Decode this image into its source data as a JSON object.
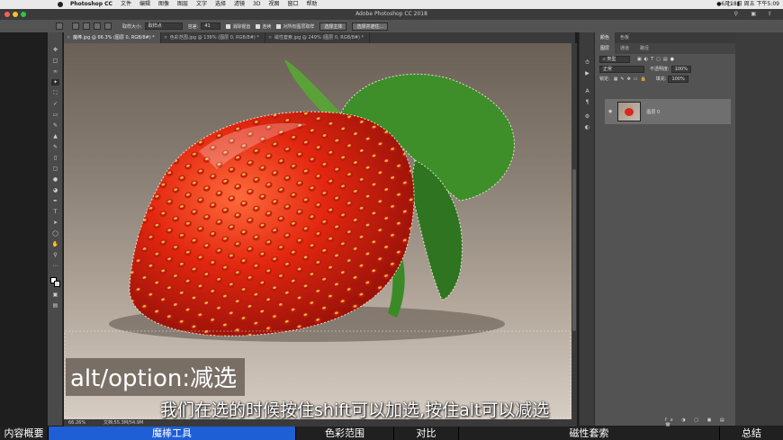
{
  "menubar": {
    "app": "Photoshop CC",
    "items": [
      "文件",
      "编辑",
      "图像",
      "图层",
      "文字",
      "选择",
      "滤镜",
      "3D",
      "视图",
      "窗口",
      "帮助"
    ],
    "clock": "6月18日 周五 下午5:09"
  },
  "window": {
    "title": "Adobe Photoshop CC 2018"
  },
  "options": {
    "sample_size_label": "取样大小:",
    "sample_size_value": "取样点",
    "tolerance_label": "容差:",
    "tolerance_value": "41",
    "antialias_label": "消除锯齿",
    "contiguous_label": "连续",
    "all_layers_label": "对所有图层取样",
    "select_subject": "选择主体",
    "select_mask": "选择并遮住..."
  },
  "tabs": [
    {
      "label": "魔棒.jpg @ 66.3% (图层 0, RGB/8#) *"
    },
    {
      "label": "色彩范围.jpg @ 138% (图层 0, RGB/8#) *"
    },
    {
      "label": "磁性套索.jpg @ 249% (图层 0, RGB/8#) *"
    }
  ],
  "status": {
    "zoom": "66.26%",
    "doc": "文档:55.3M/54.9M"
  },
  "panel": {
    "tabs": [
      "图层",
      "通道",
      "路径"
    ],
    "top_tabs": [
      "颜色",
      "色板"
    ],
    "kind": "类型",
    "blend": "正常",
    "opacity_label": "不透明度:",
    "opacity_value": "100%",
    "lock_label": "锁定:",
    "fill_label": "填充:",
    "fill_value": "100%",
    "layer_name": "图层 0"
  },
  "caption": {
    "tip": "alt/option:减选",
    "subtitle": "我们在选的时候按住shift可以加选,按住alt可以减选"
  },
  "chapters": [
    {
      "label": "内容概要",
      "active": false
    },
    {
      "label": "魔棒工具",
      "active": true
    },
    {
      "label": "色彩范围",
      "active": false
    },
    {
      "label": "对比",
      "active": false
    },
    {
      "label": "磁性套索",
      "active": false
    },
    {
      "label": "总结",
      "active": false
    }
  ],
  "colors": {
    "accent": "#1f5fd6",
    "ps_panel": "#535353",
    "ps_dark": "#3a3a3a"
  }
}
